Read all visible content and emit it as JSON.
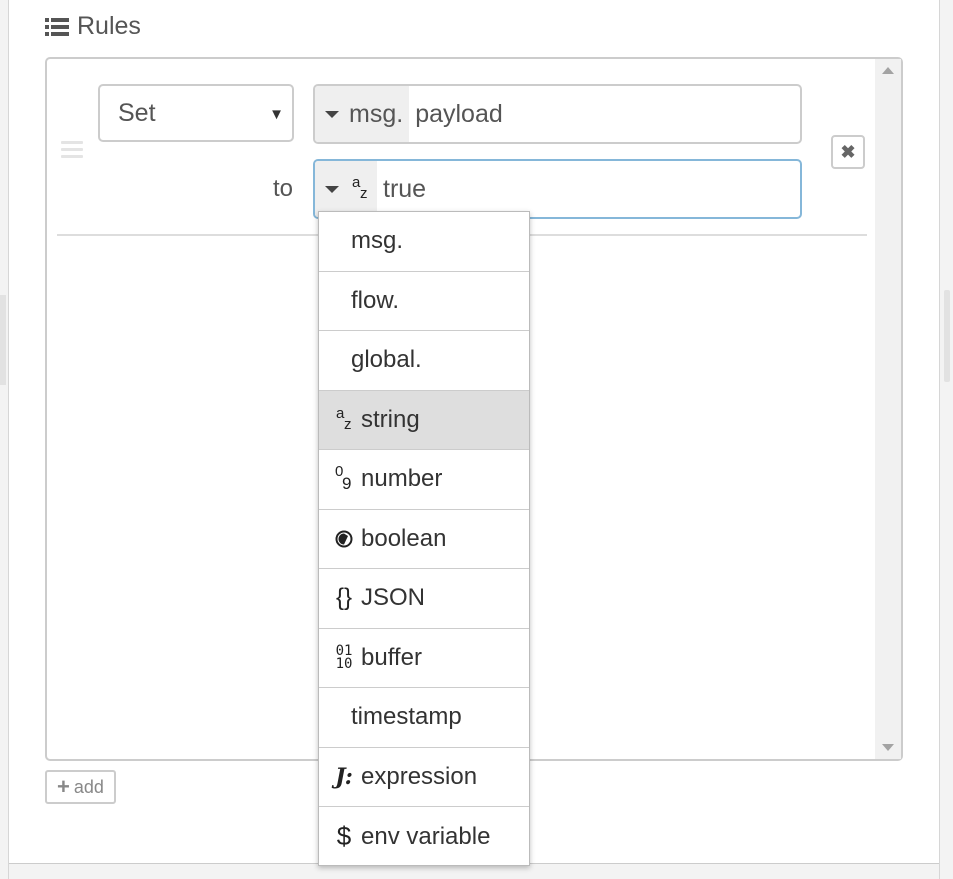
{
  "header": {
    "title": "Rules"
  },
  "rule": {
    "action": "Set",
    "target_type": "msg.",
    "target_value": "payload",
    "to_label": "to",
    "value_type_icon": "az-string-icon",
    "value": "true"
  },
  "add_button": {
    "label": "add"
  },
  "type_menu": {
    "selected": "string",
    "options": [
      {
        "label": "msg.",
        "icon": ""
      },
      {
        "label": "flow.",
        "icon": ""
      },
      {
        "label": "global.",
        "icon": ""
      },
      {
        "label": "string",
        "icon": "az-string-icon"
      },
      {
        "label": "number",
        "icon": "number-09-icon"
      },
      {
        "label": "boolean",
        "icon": "boolean-icon"
      },
      {
        "label": "JSON",
        "icon": "braces-icon"
      },
      {
        "label": "buffer",
        "icon": "binary-icon"
      },
      {
        "label": "timestamp",
        "icon": ""
      },
      {
        "label": "expression",
        "icon": "jsonata-icon"
      },
      {
        "label": "env variable",
        "icon": "dollar-icon"
      }
    ]
  },
  "colors": {
    "focus_border": "#85b7d9",
    "selected_option_bg": "#dedede",
    "type_button_bg": "#efefef"
  }
}
